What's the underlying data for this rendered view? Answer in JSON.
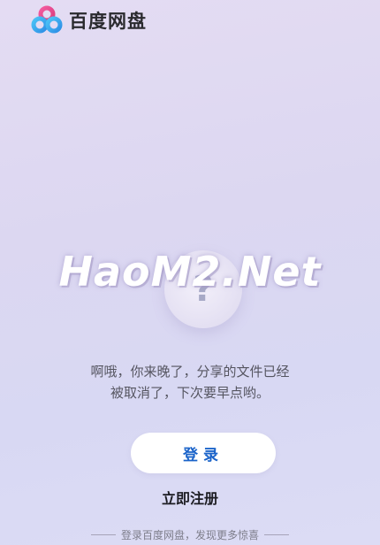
{
  "header": {
    "brand": "百度网盘"
  },
  "watermark": "HaoM2.Net",
  "illustration": {
    "icon": "question-mark-icon",
    "glyph": "?"
  },
  "message": {
    "line1": "啊哦，你来晚了，分享的文件已经",
    "line2": "被取消了，下次要早点哟。"
  },
  "actions": {
    "login_label": "登录",
    "register_label": "立即注册"
  },
  "footer": {
    "text": "登录百度网盘，发现更多惊喜"
  },
  "colors": {
    "accent": "#1a63c9",
    "logo_pink": "#e9478a",
    "logo_blue": "#3fb2f0"
  }
}
